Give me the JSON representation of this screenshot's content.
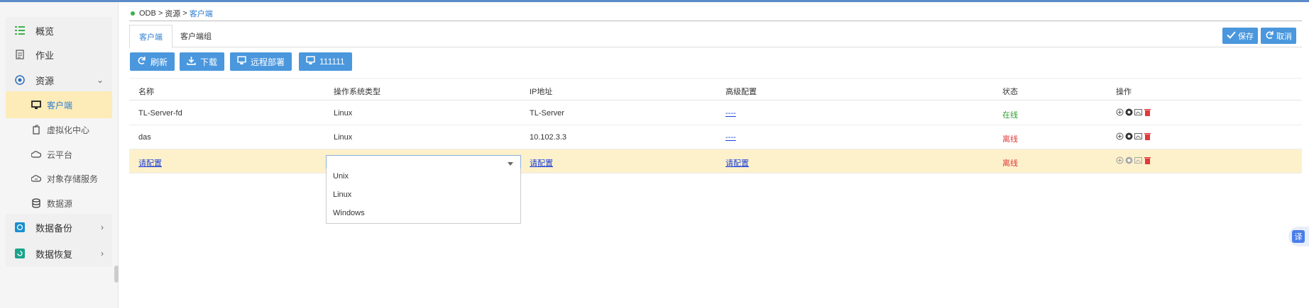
{
  "breadcrumb": {
    "root": "ODB",
    "sep": ">",
    "mid": "资源",
    "current": "客户端"
  },
  "sidebar": {
    "overview": "概览",
    "job": "作业",
    "resource": "资源",
    "sub": {
      "client": "客户端",
      "virtual": "虚拟化中心",
      "cloud": "云平台",
      "object_storage": "对象存储服务",
      "datasource": "数据源"
    },
    "backup": "数据备份",
    "restore": "数据恢复"
  },
  "tabs": {
    "client": "客户端",
    "client_group": "客户端组"
  },
  "toolbar": {
    "refresh": "刷新",
    "download": "下载",
    "remote_deploy": "远程部署",
    "custom": "111111"
  },
  "top_actions": {
    "save": "保存",
    "cancel": "取消"
  },
  "table": {
    "headers": {
      "name": "名称",
      "os": "操作系统类型",
      "ip": "IP地址",
      "advanced": "高级配置",
      "status": "状态",
      "ops": "操作"
    },
    "rows": [
      {
        "name": "TL-Server-fd",
        "os": "Linux",
        "ip": "TL-Server",
        "advanced": "----",
        "status": "在线"
      },
      {
        "name": "das",
        "os": "Linux",
        "ip": "10.102.3.3",
        "advanced": "----",
        "status": "离线"
      },
      {
        "name": "请配置",
        "os": "",
        "ip": "请配置",
        "advanced": "请配置",
        "status": "离线"
      }
    ]
  },
  "dropdown": {
    "options": [
      "Unix",
      "Linux",
      "Windows"
    ]
  },
  "translate": {
    "label": "译"
  },
  "colors": {
    "accent": "#4a97dd",
    "active_bg": "#fdebb8",
    "online": "#2f9e2f",
    "offline": "#e03a3a",
    "link": "#1a3fd6"
  }
}
